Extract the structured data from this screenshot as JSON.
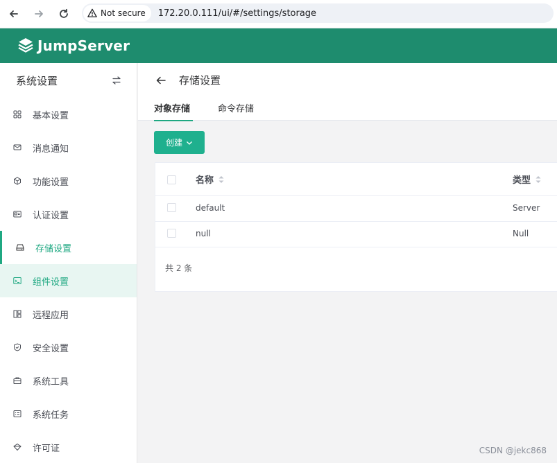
{
  "browser": {
    "secure_label": "Not secure",
    "url": "172.20.0.111/ui/#/settings/storage"
  },
  "header": {
    "brand": "JumpServer",
    "brand_color": "#1e8c6e"
  },
  "sidebar": {
    "title": "系统设置",
    "items": [
      {
        "label": "基本设置",
        "icon": "grid-icon"
      },
      {
        "label": "消息通知",
        "icon": "message-icon"
      },
      {
        "label": "功能设置",
        "icon": "cube-icon"
      },
      {
        "label": "认证设置",
        "icon": "id-card-icon"
      },
      {
        "label": "存储设置",
        "icon": "storage-icon",
        "state": "active"
      },
      {
        "label": "组件设置",
        "icon": "terminal-icon",
        "state": "hover"
      },
      {
        "label": "远程应用",
        "icon": "apps-icon"
      },
      {
        "label": "安全设置",
        "icon": "shield-icon"
      },
      {
        "label": "系统工具",
        "icon": "toolbox-icon"
      },
      {
        "label": "系统任务",
        "icon": "task-icon"
      },
      {
        "label": "许可证",
        "icon": "license-icon"
      }
    ]
  },
  "main": {
    "title": "存储设置",
    "tabs": [
      {
        "label": "对象存储",
        "active": true
      },
      {
        "label": "命令存储",
        "active": false
      }
    ],
    "create_label": "创建",
    "table": {
      "columns": [
        "名称",
        "类型"
      ],
      "rows": [
        {
          "name": "default",
          "type": "Server"
        },
        {
          "name": "null",
          "type": "Null"
        }
      ],
      "total": "共 2 条"
    }
  },
  "watermark": "CSDN @jekc868",
  "accent_color": "#1fa882"
}
